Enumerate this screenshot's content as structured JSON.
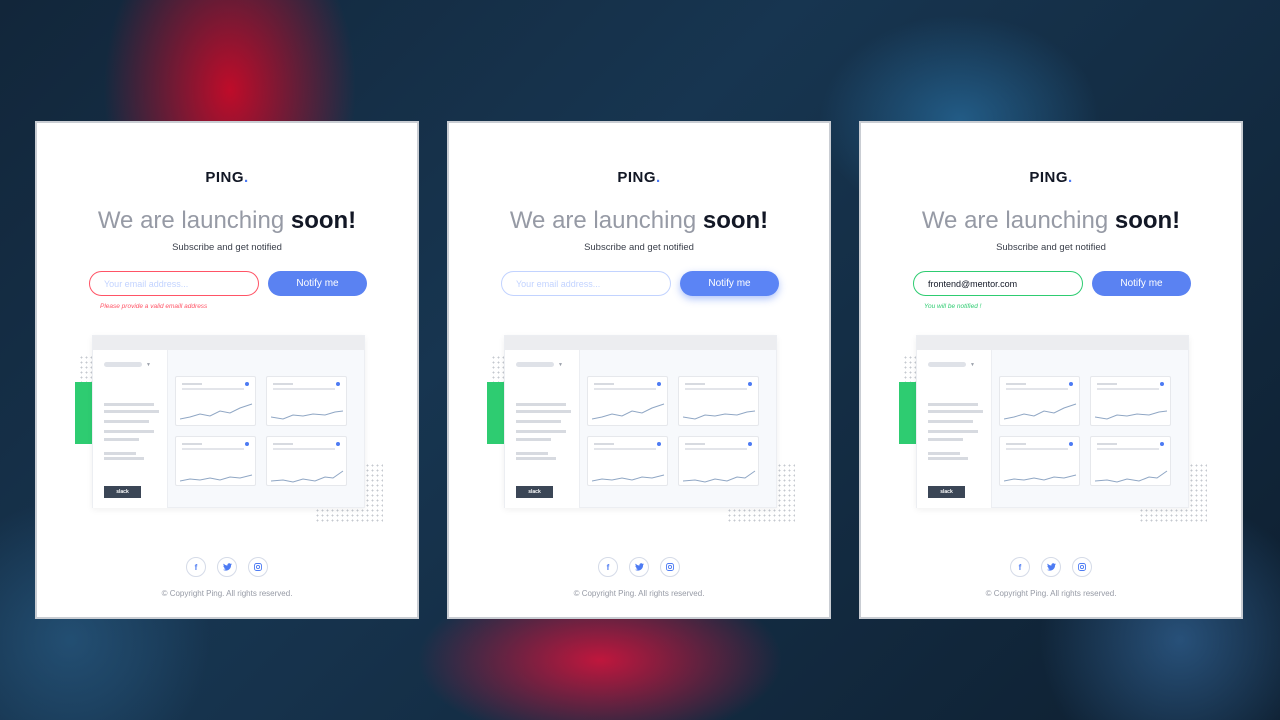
{
  "accent_color": "#4d7bf3",
  "error_color": "#ff5466",
  "success_color": "#2ecc71",
  "cards": [
    {
      "state": "error",
      "logo_text": "PING",
      "logo_dot": ".",
      "headline_light": "We are launching ",
      "headline_bold": "soon!",
      "subtitle": "Subscribe and get notified",
      "email_placeholder": "Your email address...",
      "email_value": "",
      "button_label": "Notify me",
      "message": "Please provide a valid emaill address",
      "slack_label": "slack",
      "social_icons": [
        "facebook-icon",
        "twitter-icon",
        "instagram-icon"
      ],
      "copyright": "© Copyright Ping. All rights reserved."
    },
    {
      "state": "hover",
      "logo_text": "PING",
      "logo_dot": ".",
      "headline_light": "We are launching ",
      "headline_bold": "soon!",
      "subtitle": "Subscribe and get notified",
      "email_placeholder": "Your email address...",
      "email_value": "",
      "button_label": "Notify me",
      "message": "",
      "slack_label": "slack",
      "social_icons": [
        "facebook-icon",
        "twitter-icon",
        "instagram-icon"
      ],
      "copyright": "© Copyright Ping. All rights reserved."
    },
    {
      "state": "success",
      "logo_text": "PING",
      "logo_dot": ".",
      "headline_light": "We are launching ",
      "headline_bold": "soon!",
      "subtitle": "Subscribe and get notified",
      "email_placeholder": "Your email address...",
      "email_value": "frontend@mentor.com",
      "button_label": "Notify me",
      "message": "You will be notified !",
      "slack_label": "slack",
      "social_icons": [
        "facebook-icon",
        "twitter-icon",
        "instagram-icon"
      ],
      "copyright": "© Copyright Ping. All rights reserved."
    }
  ]
}
